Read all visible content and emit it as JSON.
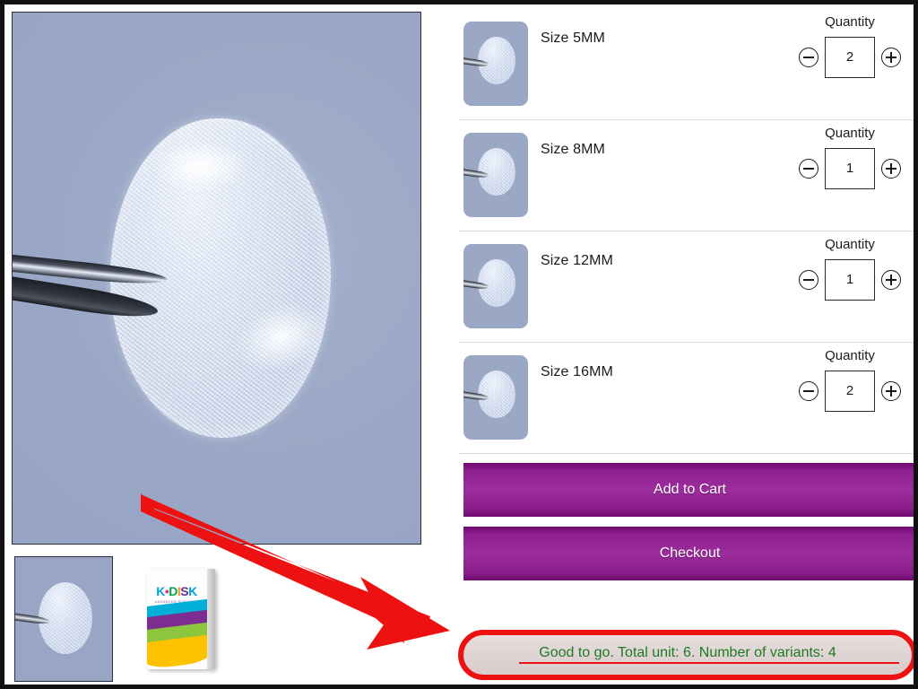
{
  "product": {
    "hero_image_alt": "tweezers-holding-translucent-disk",
    "gallery_thumbnails": [
      {
        "name": "product-photo-thumbnail",
        "selected": true
      },
      {
        "name": "product-box-thumbnail",
        "selected": false
      }
    ],
    "box_logo": {
      "letters": [
        "K",
        "•",
        "D",
        "I",
        "S",
        "K"
      ],
      "subtitle": "ADVANCED SURGICAL TECHNOLOGY"
    }
  },
  "variants": [
    {
      "label": "Size 5MM",
      "quantity": "2",
      "qty_label": "Quantity",
      "decrement": "−",
      "increment": "+"
    },
    {
      "label": "Size 8MM",
      "quantity": "1",
      "qty_label": "Quantity",
      "decrement": "−",
      "increment": "+"
    },
    {
      "label": "Size 12MM",
      "quantity": "1",
      "qty_label": "Quantity",
      "decrement": "−",
      "increment": "+"
    },
    {
      "label": "Size 16MM",
      "quantity": "2",
      "qty_label": "Quantity",
      "decrement": "−",
      "increment": "+"
    }
  ],
  "actions": {
    "add_to_cart": "Add to Cart",
    "checkout": "Checkout"
  },
  "status": {
    "message": "Good to go. Total unit: 6. Number of variants: 4",
    "total_units": 6,
    "number_of_variants": 4
  },
  "annotation": {
    "arrow_color": "#ee1111",
    "highlight_ring_color": "#ee1111"
  },
  "colors": {
    "button_purple": "#9c2d9c",
    "status_text_green": "#1d7a22",
    "photo_background": "#98a5c4",
    "page_border": "#111111",
    "divider": "#dcdcdc"
  }
}
